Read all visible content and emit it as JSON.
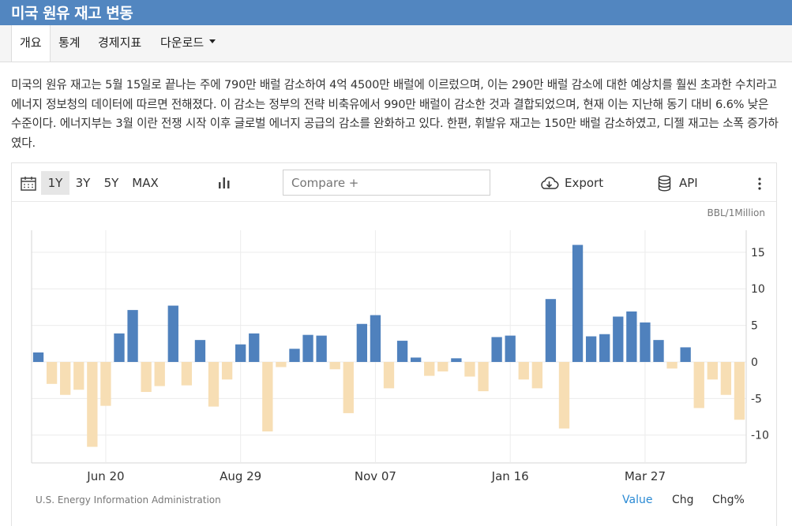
{
  "header": {
    "title": "미국 원유 재고 변동"
  },
  "tabs": [
    {
      "label": "개요"
    },
    {
      "label": "통계"
    },
    {
      "label": "경제지표"
    },
    {
      "label": "다운로드"
    }
  ],
  "description": "미국의 원유 재고는 5월 15일로 끝나는 주에 790만 배럴 감소하여 4억 4500만 배럴에 이르렀으며, 이는 290만 배럴 감소에 대한 예상치를 훨씬 초과한 수치라고 에너지 정보청의 데이터에 따르면 전해졌다. 이 감소는 정부의 전략 비축유에서 990만 배럴이 감소한 것과 결합되었으며, 현재 이는 지난해 동기 대비 6.6% 낮은 수준이다. 에너지부는 3월 이란 전쟁 시작 이후 글로벌 에너지 공급의 감소를 완화하고 있다. 한편, 휘발유 재고는 150만 배럴 감소하였고, 디젤 재고는 소폭 증가하였다.",
  "toolbar": {
    "ranges": [
      "1Y",
      "3Y",
      "5Y",
      "MAX"
    ],
    "active_range": "1Y",
    "compare_placeholder": "Compare +",
    "export_label": "Export",
    "api_label": "API"
  },
  "colors": {
    "positive": "#4f81bd",
    "negative": "#f7deb4",
    "header": "#5286c0",
    "active_link": "#2a8ad4"
  },
  "chart_data": {
    "type": "bar",
    "unit_label": "BBL/1Million",
    "x_tick_labels": [
      "Jun 20",
      "Aug 29",
      "Nov 07",
      "Jan 16",
      "Mar 27"
    ],
    "x_tick_indices": [
      5,
      15,
      25,
      35,
      45
    ],
    "y_ticks": [
      15,
      10,
      5,
      0,
      -5,
      -10
    ],
    "ylim": [
      -13.8,
      18
    ],
    "values": [
      1.3,
      -3.0,
      -4.5,
      -3.8,
      -11.6,
      -6.0,
      3.9,
      7.1,
      -4.1,
      -3.3,
      7.7,
      -3.2,
      3.0,
      -6.1,
      -2.4,
      2.4,
      3.9,
      -9.5,
      -0.7,
      1.8,
      3.7,
      3.6,
      -1.0,
      -7.0,
      5.2,
      6.4,
      -3.6,
      2.9,
      0.6,
      -1.9,
      -1.3,
      0.5,
      -2.0,
      -4.0,
      3.4,
      3.6,
      -2.4,
      -3.6,
      8.6,
      -9.1,
      16.0,
      3.5,
      3.8,
      6.2,
      6.9,
      5.4,
      3.0,
      -0.9,
      2.0,
      -6.3,
      -2.4,
      -4.5,
      -7.9
    ],
    "grid": true
  },
  "footer": {
    "source": "U.S. Energy Information Administration",
    "view_options": [
      "Value",
      "Chg",
      "Chg%"
    ],
    "active_view": "Value"
  }
}
